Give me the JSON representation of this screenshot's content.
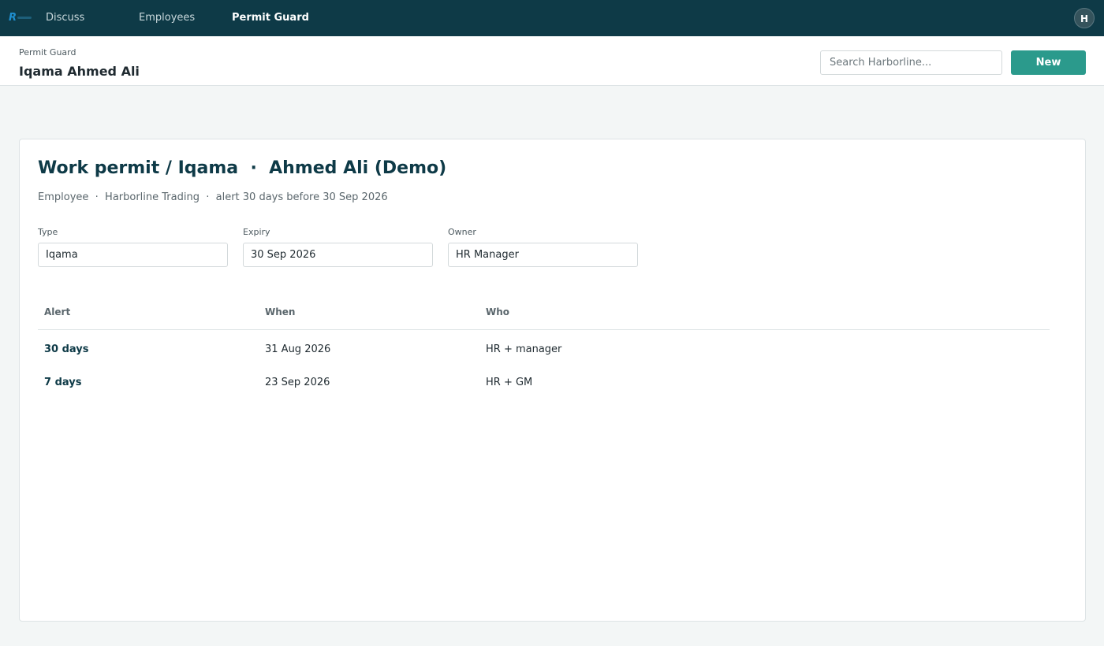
{
  "nav": {
    "items": [
      {
        "label": "Discuss"
      },
      {
        "label": "Employees"
      },
      {
        "label": "Permit Guard"
      }
    ],
    "avatar_initial": "H"
  },
  "control": {
    "breadcrumb": "Permit Guard",
    "title": "Iqama Ahmed Ali",
    "search_placeholder": "Search Harborline...",
    "new_label": "New"
  },
  "record": {
    "title": "Work permit / Iqama  ·  Ahmed Ali (Demo)",
    "meta": "Employee  ·  Harborline Trading  ·  alert 30 days before 30 Sep 2026",
    "fields": {
      "type": {
        "label": "Type",
        "value": "Iqama"
      },
      "expiry": {
        "label": "Expiry",
        "value": "30 Sep 2026"
      },
      "owner": {
        "label": "Owner",
        "value": "HR Manager"
      }
    }
  },
  "alerts": {
    "columns": [
      "Alert",
      "When",
      "Who"
    ],
    "rows": [
      {
        "alert": "30 days",
        "when": "31 Aug 2026",
        "who": "HR + manager"
      },
      {
        "alert": "7 days",
        "when": "23 Sep 2026",
        "who": "HR + GM"
      }
    ]
  },
  "colors": {
    "topbar": "#0e3a47",
    "accent": "#2b9a8c"
  }
}
